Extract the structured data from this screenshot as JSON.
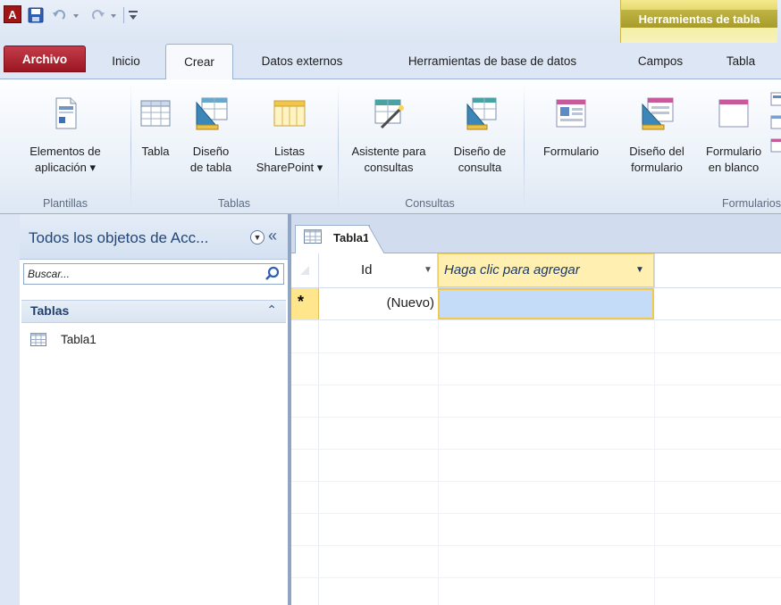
{
  "app": {
    "logo_letter": "A",
    "contextual_title": "Herramientas de tabla"
  },
  "tabs": {
    "archivo": "Archivo",
    "inicio": "Inicio",
    "crear": "Crear",
    "datos_externos": "Datos externos",
    "herramientas_bd": "Herramientas de base de datos",
    "campos": "Campos",
    "tabla": "Tabla"
  },
  "ribbon": {
    "groups": {
      "plantillas": "Plantillas",
      "tablas": "Tablas",
      "consultas": "Consultas",
      "formularios": "Formularios"
    },
    "buttons": {
      "elementos_l1": "Elementos de",
      "elementos_l2": "aplicación ▾",
      "tabla_l1": "Tabla",
      "diseno_tabla_l1": "Diseño",
      "diseno_tabla_l2": "de tabla",
      "listas_l1": "Listas",
      "listas_l2": "SharePoint ▾",
      "asistente_l1": "Asistente para",
      "asistente_l2": "consultas",
      "diseno_consulta_l1": "Diseño de",
      "diseno_consulta_l2": "consulta",
      "formulario_l1": "Formulario",
      "diseno_form_l1": "Diseño del",
      "diseno_form_l2": "formulario",
      "form_blanco_l1": "Formulario",
      "form_blanco_l2": "en blanco"
    }
  },
  "nav": {
    "title": "Todos los objetos de Acc...",
    "search_placeholder": "Buscar...",
    "group_title": "Tablas",
    "items": [
      {
        "label": "Tabla1"
      }
    ]
  },
  "document": {
    "tab_label": "Tabla1",
    "columns": {
      "id": "Id",
      "add": "Haga clic para agregar"
    },
    "new_row": {
      "marker": "*",
      "id_value": "(Nuevo)"
    }
  },
  "colors": {
    "archivo_tab": "#9b1622",
    "contextual": "#a79b2b",
    "selection_cell": "#c5dcf8",
    "active_border": "#f2c94c"
  }
}
